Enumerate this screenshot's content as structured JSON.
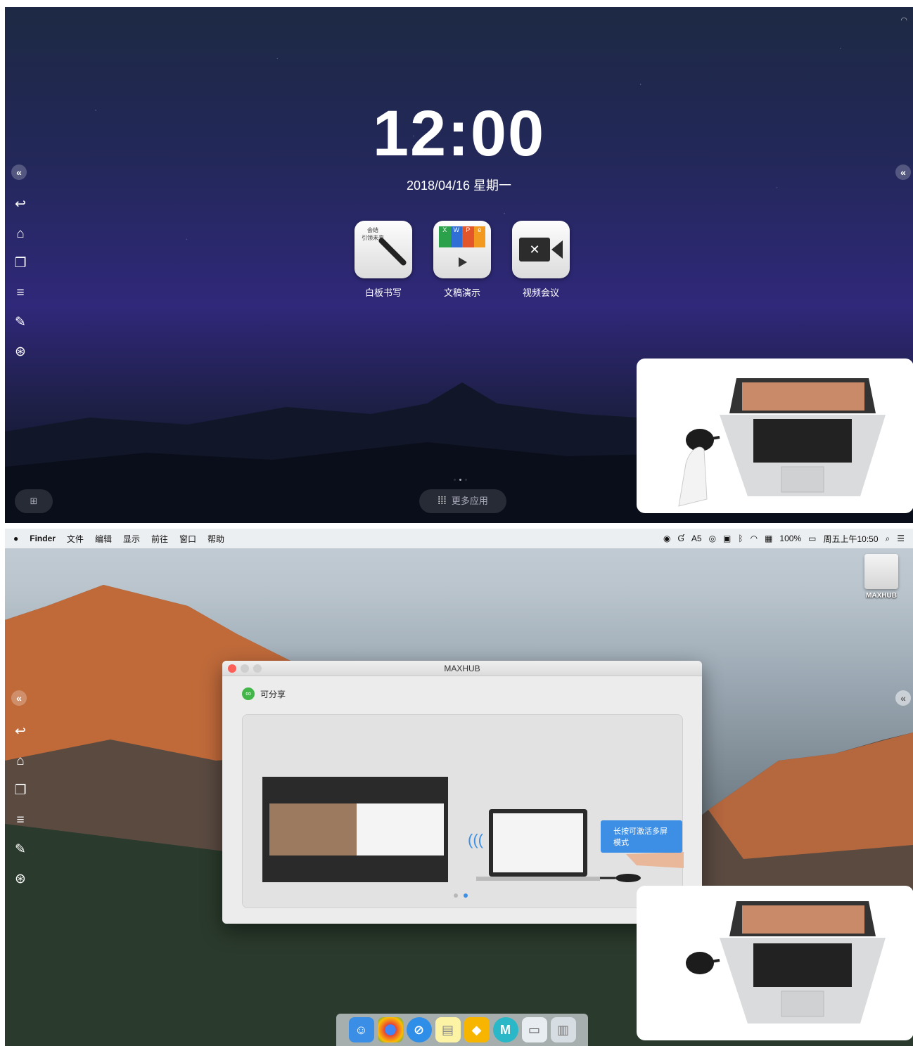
{
  "top_screen": {
    "clock": "12:00",
    "date": "2018/04/16  星期一",
    "apps": [
      {
        "label": "白板书写",
        "icon": "whiteboard-pen-icon",
        "note": "会结\n引领未来"
      },
      {
        "label": "文稿演示",
        "icon": "presentation-icon",
        "badges": [
          "X",
          "W",
          "P",
          "e"
        ]
      },
      {
        "label": "视频会议",
        "icon": "video-camera-icon"
      }
    ],
    "more_apps": "更多应用",
    "sidebar": [
      "back-icon",
      "home-icon",
      "windows-icon",
      "menu-icon",
      "pen-icon",
      "maxhub-icon"
    ]
  },
  "bottom_screen": {
    "menubar": {
      "apple": "",
      "items": [
        "Finder",
        "文件",
        "编辑",
        "显示",
        "前往",
        "窗口",
        "帮助"
      ],
      "status_app_count": "5",
      "battery": "100%",
      "clock": "周五上午10:50"
    },
    "window": {
      "title": "MAXHUB",
      "status": "可分享",
      "tooltip": "长按可激活多屏模式"
    },
    "desktop_drive": "MAXHUB",
    "dock": [
      "finder",
      "chrome",
      "safari",
      "notes",
      "sketch",
      "maxhub",
      "preview",
      "trash"
    ]
  },
  "colors": {
    "accent": "#3d8fe6",
    "share_green": "#43b64a"
  }
}
